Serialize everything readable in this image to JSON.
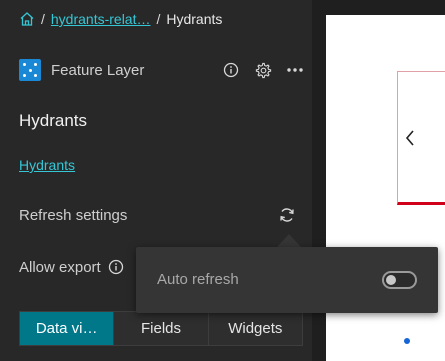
{
  "breadcrumb": {
    "home_icon": "home-icon",
    "separator": "/",
    "link_label": "hydrants-relat…",
    "current_label": "Hydrants"
  },
  "layer": {
    "type_label": "Feature Layer",
    "icons": [
      "feature-layer-icon",
      "info-icon",
      "gear-icon",
      "more-icon"
    ]
  },
  "details": {
    "title": "Hydrants",
    "title_link": "Hydrants"
  },
  "settings": {
    "refresh_label": "Refresh settings",
    "export_label": "Allow export"
  },
  "popover": {
    "auto_refresh_label": "Auto refresh",
    "auto_refresh_on": false
  },
  "tabs": [
    {
      "label": "Data vi…",
      "active": true
    },
    {
      "label": "Fields",
      "active": false
    },
    {
      "label": "Widgets",
      "active": false
    }
  ],
  "colors": {
    "accent": "#35c7d6",
    "active_tab": "#00788a",
    "layer_icon": "#1b88d6",
    "preview_border": "#d0001a"
  }
}
